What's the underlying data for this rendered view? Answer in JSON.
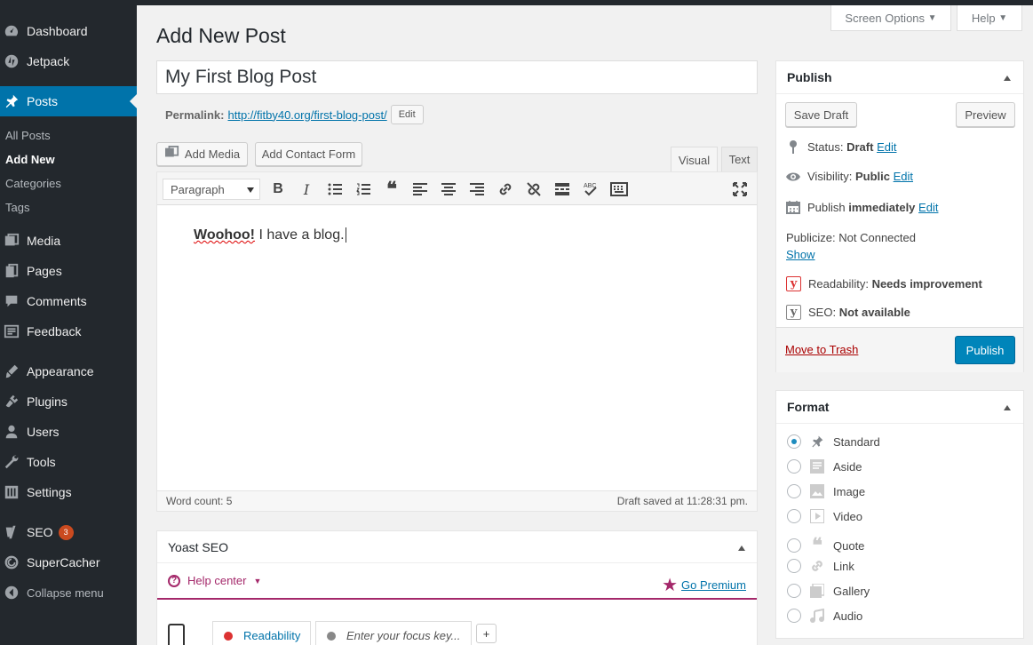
{
  "sidebar": {
    "items": [
      {
        "label": "Dashboard",
        "icon": "dashboard-icon"
      },
      {
        "label": "Jetpack",
        "icon": "jetpack-icon"
      },
      {
        "label": "Posts",
        "icon": "pushpin-icon"
      },
      {
        "label": "Media",
        "icon": "media-icon"
      },
      {
        "label": "Pages",
        "icon": "pages-icon"
      },
      {
        "label": "Comments",
        "icon": "comments-icon"
      },
      {
        "label": "Feedback",
        "icon": "feedback-icon"
      },
      {
        "label": "Appearance",
        "icon": "appearance-icon"
      },
      {
        "label": "Plugins",
        "icon": "plugins-icon"
      },
      {
        "label": "Users",
        "icon": "users-icon"
      },
      {
        "label": "Tools",
        "icon": "tools-icon"
      },
      {
        "label": "Settings",
        "icon": "settings-icon"
      },
      {
        "label": "SEO",
        "icon": "yoast-icon"
      },
      {
        "label": "SuperCacher",
        "icon": "supercacher-icon"
      }
    ],
    "submenu": [
      "All Posts",
      "Add New",
      "Categories",
      "Tags"
    ],
    "seo_badge": "3",
    "collapse_label": "Collapse menu"
  },
  "header": {
    "screen_options": "Screen Options",
    "help": "Help",
    "page_title": "Add New Post"
  },
  "post": {
    "title": "My First Blog Post",
    "permalink_label": "Permalink:",
    "permalink_url": "http://fitby40.org/first-blog-post/",
    "permalink_edit": "Edit"
  },
  "editor": {
    "add_media": "Add Media",
    "add_contact_form": "Add Contact Form",
    "tab_visual": "Visual",
    "tab_text": "Text",
    "format_select": "Paragraph",
    "content_bold": "Woohoo!",
    "content_rest": " I have a blog.",
    "word_count": "Word count: 5",
    "draft_saved": "Draft saved at 11:28:31 pm."
  },
  "yoast": {
    "title": "Yoast SEO",
    "help_center": "Help center",
    "go_premium": "Go Premium",
    "readability_tab": "Readability",
    "focus_placeholder": "Enter your focus key...",
    "add_label": "+"
  },
  "publish": {
    "title": "Publish",
    "save_draft": "Save Draft",
    "preview": "Preview",
    "status_label": "Status:",
    "status_value": "Draft",
    "visibility_label": "Visibility:",
    "visibility_value": "Public",
    "publish_label": "Publish",
    "publish_value": "immediately",
    "edit": "Edit",
    "publicize": "Publicize: Not Connected",
    "show": "Show",
    "readability_label": "Readability:",
    "readability_value": "Needs improvement",
    "seo_label": "SEO:",
    "seo_value": "Not available",
    "move_to_trash": "Move to Trash",
    "publish_button": "Publish"
  },
  "format": {
    "title": "Format",
    "options": [
      "Standard",
      "Aside",
      "Image",
      "Video",
      "Quote",
      "Link",
      "Gallery",
      "Audio"
    ],
    "selected": "Standard"
  },
  "colors": {
    "sidebar_bg": "#23282d",
    "accent": "#0073aa",
    "yoast": "#a4286a",
    "publish_button": "#0085ba"
  }
}
